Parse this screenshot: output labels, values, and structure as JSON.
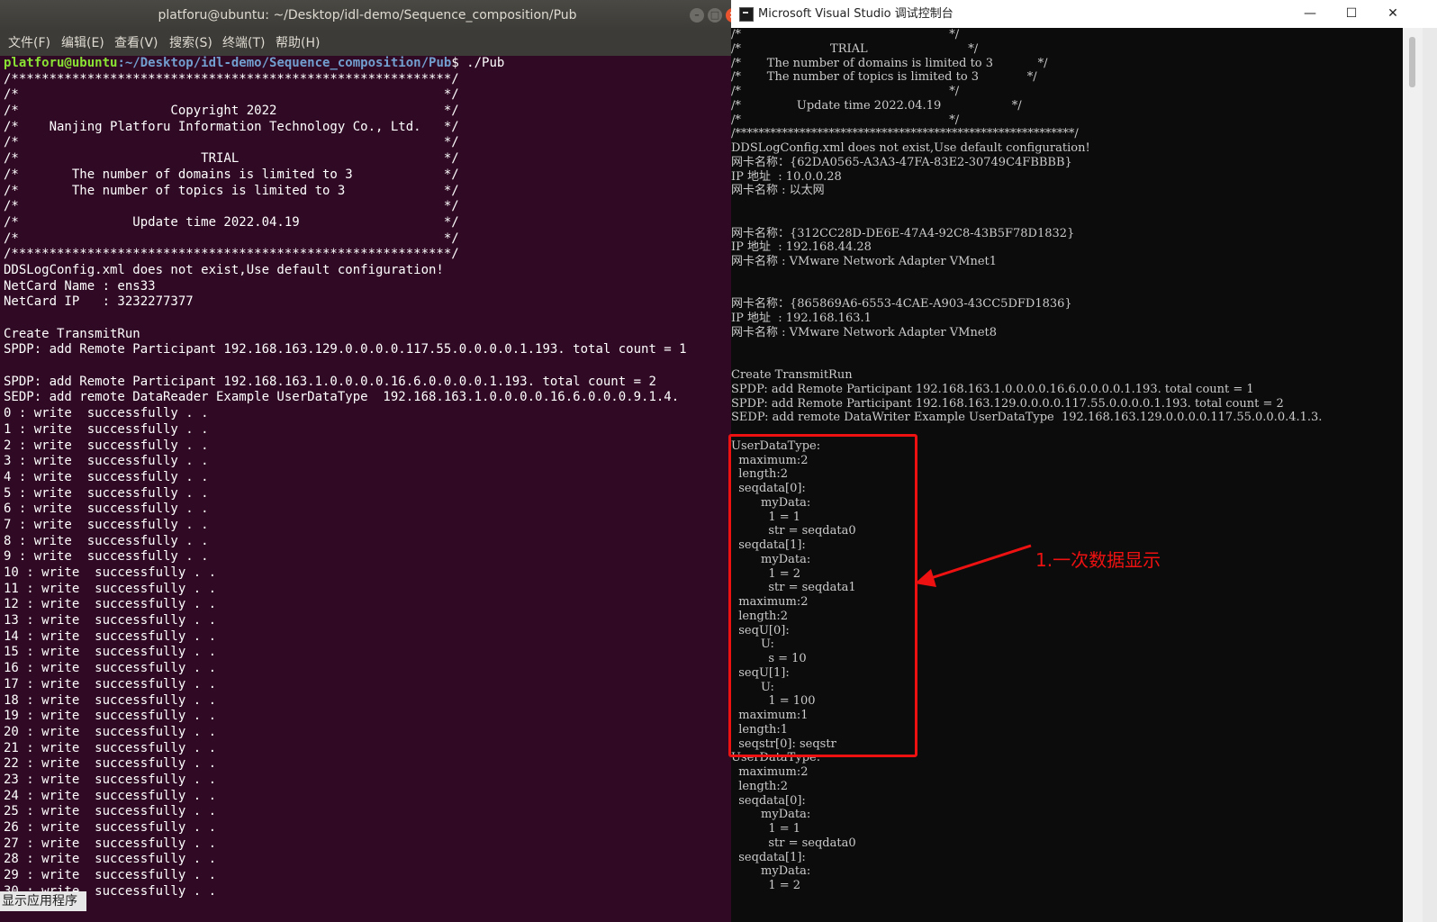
{
  "terminal": {
    "title": "platforu@ubuntu: ~/Desktop/idl-demo/Sequence_composition/Pub",
    "window_buttons": {
      "minimize": "–",
      "maximize": "□",
      "close": "×"
    },
    "menu": [
      "文件(F)",
      "编辑(E)",
      "查看(V)",
      "搜索(S)",
      "终端(T)",
      "帮助(H)"
    ],
    "prompt": {
      "user": "platforu@ubuntu",
      "path": ":~/Desktop/idl-demo/Sequence_composition/Pub",
      "command": "$ ./Pub"
    },
    "lines": [
      "/**********************************************************/",
      "/*                                                        */",
      "/*                    Copyright 2022                      */",
      "/*    Nanjing Platforu Information Technology Co., Ltd.   */",
      "/*                                                        */",
      "/*                        TRIAL                           */",
      "/*       The number of domains is limited to 3            */",
      "/*       The number of topics is limited to 3             */",
      "/*                                                        */",
      "/*               Update time 2022.04.19                   */",
      "/*                                                        */",
      "/**********************************************************/",
      "DDSLogConfig.xml does not exist,Use default configuration!",
      "NetCard Name : ens33",
      "NetCard IP   : 3232277377",
      "",
      "Create TransmitRun",
      "SPDP: add Remote Participant 192.168.163.129.0.0.0.0.117.55.0.0.0.0.1.193. total count = 1",
      "",
      "SPDP: add Remote Participant 192.168.163.1.0.0.0.0.16.6.0.0.0.0.1.193. total count = 2",
      "SEDP: add remote DataReader Example UserDataType  192.168.163.1.0.0.0.0.16.6.0.0.0.9.1.4.",
      "0 : write  successfully . .",
      "1 : write  successfully . .",
      "2 : write  successfully . .",
      "3 : write  successfully . .",
      "4 : write  successfully . .",
      "5 : write  successfully . .",
      "6 : write  successfully . .",
      "7 : write  successfully . .",
      "8 : write  successfully . .",
      "9 : write  successfully . .",
      "10 : write  successfully . .",
      "11 : write  successfully . .",
      "12 : write  successfully . .",
      "13 : write  successfully . .",
      "14 : write  successfully . .",
      "15 : write  successfully . .",
      "16 : write  successfully . .",
      "17 : write  successfully . .",
      "18 : write  successfully . .",
      "19 : write  successfully . .",
      "20 : write  successfully . .",
      "21 : write  successfully . .",
      "22 : write  successfully . .",
      "23 : write  successfully . .",
      "24 : write  successfully . .",
      "25 : write  successfully . .",
      "26 : write  successfully . .",
      "27 : write  successfully . .",
      "28 : write  successfully . .",
      "29 : write  successfully . .",
      "30 : write  successfully . ."
    ],
    "taskbar_tip": "显示应用程序"
  },
  "console": {
    "title": "Microsoft Visual Studio 调试控制台",
    "window_buttons": {
      "minimize": "—",
      "maximize": "☐",
      "close": "✕"
    },
    "lines": [
      "/*                                                        */",
      "/*                        TRIAL                           */",
      "/*       The number of domains is limited to 3            */",
      "/*       The number of topics is limited to 3             */",
      "/*                                                        */",
      "/*               Update time 2022.04.19                   */",
      "/*                                                        */",
      "/**********************************************************/",
      "DDSLogConfig.xml does not exist,Use default configuration!",
      "网卡名称：{62DA0565-A3A3-47FA-83E2-30749C4FBBBB}",
      "IP 地址  : 10.0.0.28",
      "网卡名称 : 以太网",
      "",
      "",
      "网卡名称：{312CC28D-DE6E-47A4-92C8-43B5F78D1832}",
      "IP 地址  : 192.168.44.28",
      "网卡名称 : VMware Network Adapter VMnet1",
      "",
      "",
      "网卡名称：{865869A6-6553-4CAE-A903-43CC5DFD1836}",
      "IP 地址  : 192.168.163.1",
      "网卡名称 : VMware Network Adapter VMnet8",
      "",
      "",
      "Create TransmitRun",
      "SPDP: add Remote Participant 192.168.163.1.0.0.0.0.16.6.0.0.0.0.1.193. total count = 1",
      "SPDP: add Remote Participant 192.168.163.129.0.0.0.0.117.55.0.0.0.0.1.193. total count = 2",
      "SEDP: add remote DataWriter Example UserDataType  192.168.163.129.0.0.0.0.117.55.0.0.0.4.1.3.",
      "",
      "UserDataType:",
      "  maximum:2",
      "  length:2",
      "  seqdata[0]:",
      "        myData:",
      "          1 = 1",
      "          str = seqdata0",
      "  seqdata[1]:",
      "        myData:",
      "          1 = 2",
      "          str = seqdata1",
      "  maximum:2",
      "  length:2",
      "  seqU[0]:",
      "        U:",
      "          s = 10",
      "  seqU[1]:",
      "        U:",
      "          1 = 100",
      "  maximum:1",
      "  length:1",
      "  seqstr[0]: seqstr",
      "UserDataType:",
      "  maximum:2",
      "  length:2",
      "  seqdata[0]:",
      "        myData:",
      "          1 = 1",
      "          str = seqdata0",
      "  seqdata[1]:",
      "        myData:",
      "          1 = 2"
    ]
  },
  "annotation": {
    "label": "1.一次数据显示",
    "color": "#ee1111"
  }
}
